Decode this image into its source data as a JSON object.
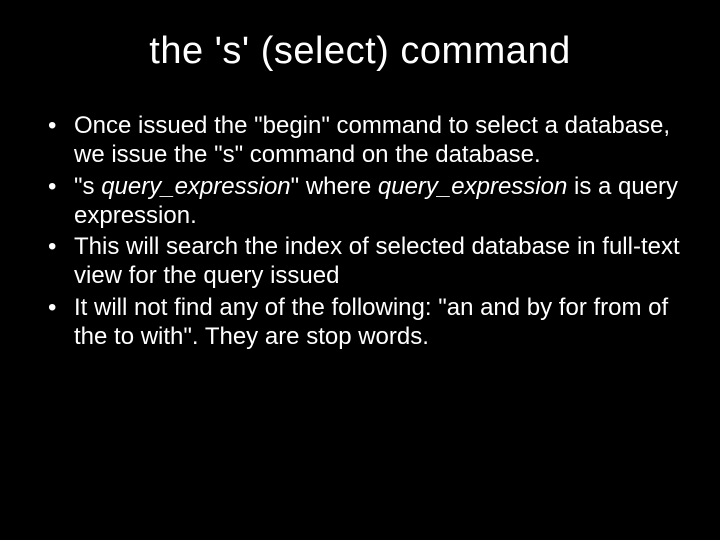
{
  "title": "the 's' (select) command",
  "bullets": {
    "b0": "Once issued the \"begin\" command to select a database, we issue the \"s\" command on the database.",
    "b1_pre": "\"s ",
    "b1_qe1": "query_expression",
    "b1_mid": "\" where ",
    "b1_qe2": "query_expression",
    "b1_post": " is a query expression.",
    "b2": "This will search the index of selected database in full-text view for the  query issued",
    "b3": "It will not find any of the following: \"an and by for from of the to with\". They are stop words."
  }
}
